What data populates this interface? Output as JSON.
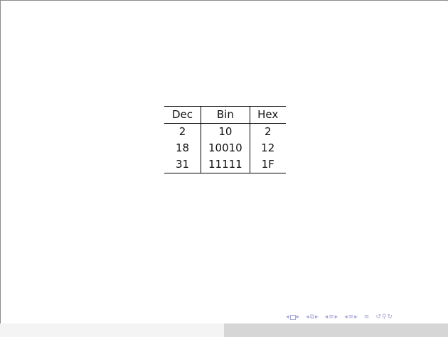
{
  "table": {
    "headers": [
      "Dec",
      "Bin",
      "Hex"
    ],
    "rows": [
      [
        "2",
        "10",
        "2"
      ],
      [
        "18",
        "10010",
        "12"
      ],
      [
        "31",
        "11111",
        "1F"
      ]
    ]
  },
  "navigation": {
    "icons": [
      "nav-first-icon",
      "nav-frame-icon",
      "nav-last-icon",
      "nav-prev-section-icon",
      "nav-section-icon",
      "nav-next-section-icon",
      "nav-prev-subsection-icon",
      "nav-subsection-icon",
      "nav-next-subsection-icon",
      "nav-prev-slide-icon",
      "nav-slide-icon",
      "nav-next-slide-icon",
      "nav-toc-icon",
      "nav-back-icon",
      "nav-search-icon",
      "nav-forward-icon"
    ],
    "color": "#a8a8d8"
  },
  "colors": {
    "background": "#ffffff",
    "rule": "#000000",
    "scrollbar_track": "#f4f4f4",
    "scrollbar_thumb": "#d6d6d6"
  }
}
